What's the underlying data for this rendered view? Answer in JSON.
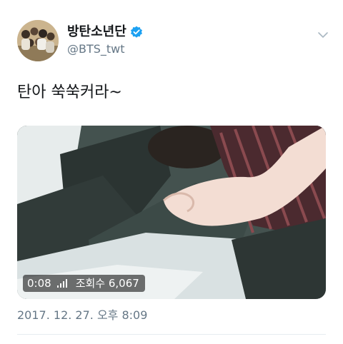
{
  "user": {
    "display_name": "방탄소년단",
    "handle": "@BTS_twt",
    "verified_color": "#1da1f2",
    "avatar_icon": "group-photo-avatar"
  },
  "tweet": {
    "text": "탄아 쑥쑥커라~",
    "timestamp": "2017. 12. 27. 오후 8:09"
  },
  "media": {
    "type": "video",
    "duration": "0:08",
    "views_label": "조회수 6,067"
  },
  "icons": {
    "menu": "chevron-down-icon",
    "verified": "verified-badge-icon",
    "signal": "signal-bars-icon"
  }
}
